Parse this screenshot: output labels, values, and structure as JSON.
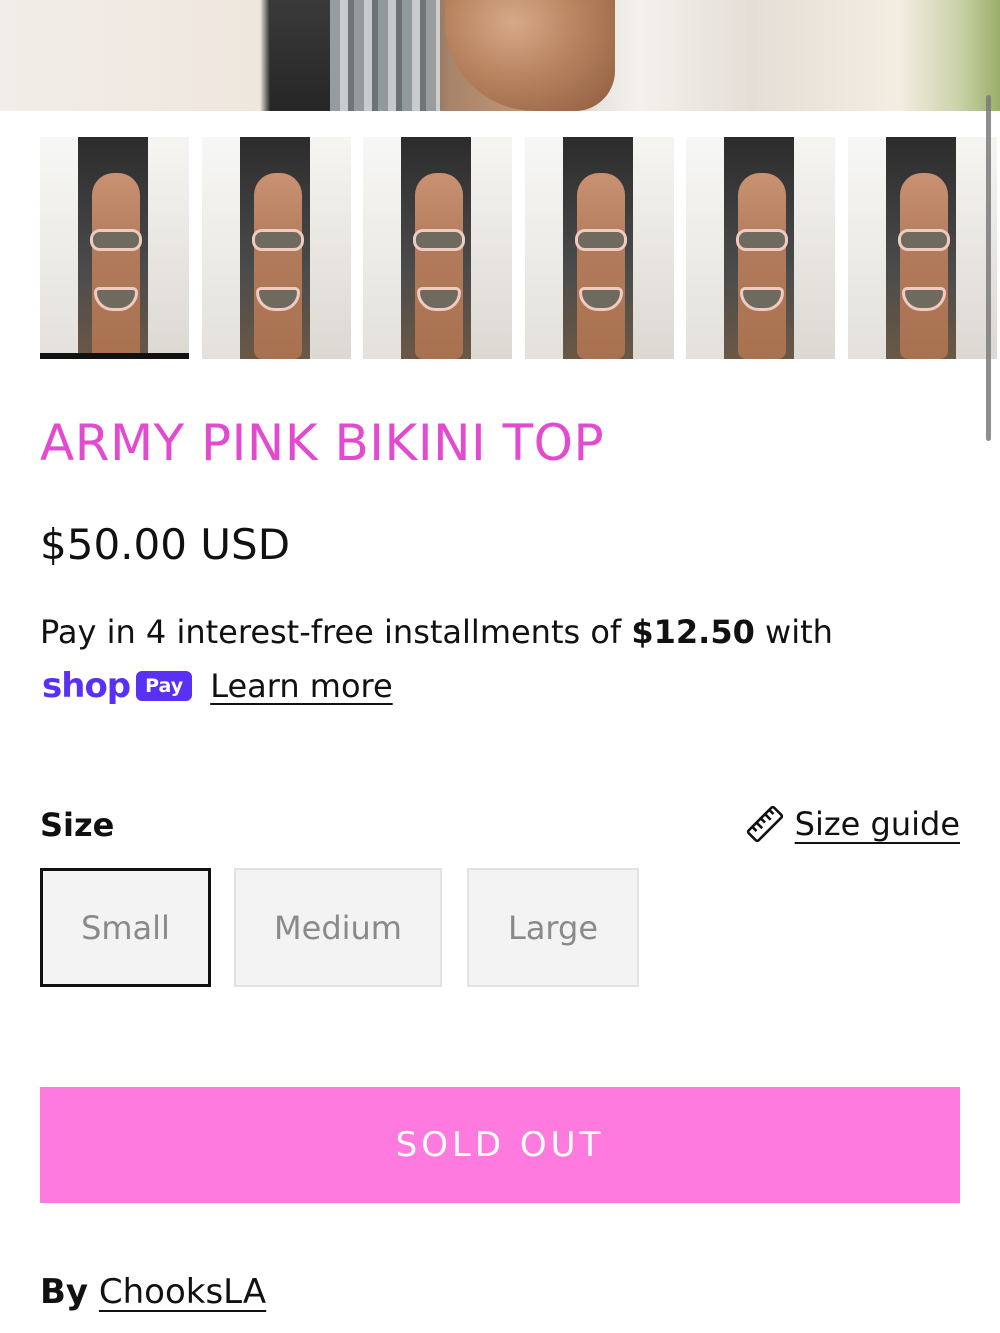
{
  "product": {
    "title": "ARMY PINK BIKINI TOP",
    "price": "$50.00 USD",
    "title_color": "#e24ad0"
  },
  "installments": {
    "text_before": "Pay in 4 interest-free installments of ",
    "amount": "$12.50",
    "text_after": " with",
    "shop_word": "shop",
    "pay_badge": "Pay",
    "learn_more": "Learn more",
    "brand_color": "#5a31f4"
  },
  "gallery": {
    "thumbnail_count": 6,
    "active_index": 0
  },
  "size": {
    "label": "Size",
    "guide_label": "Size guide",
    "guide_icon": "ruler-icon",
    "options": [
      "Small",
      "Medium",
      "Large"
    ],
    "selected": "Small"
  },
  "cta": {
    "label": "SOLD OUT",
    "color": "#ff7ade"
  },
  "vendor": {
    "prefix": "By",
    "name": "ChooksLA"
  }
}
